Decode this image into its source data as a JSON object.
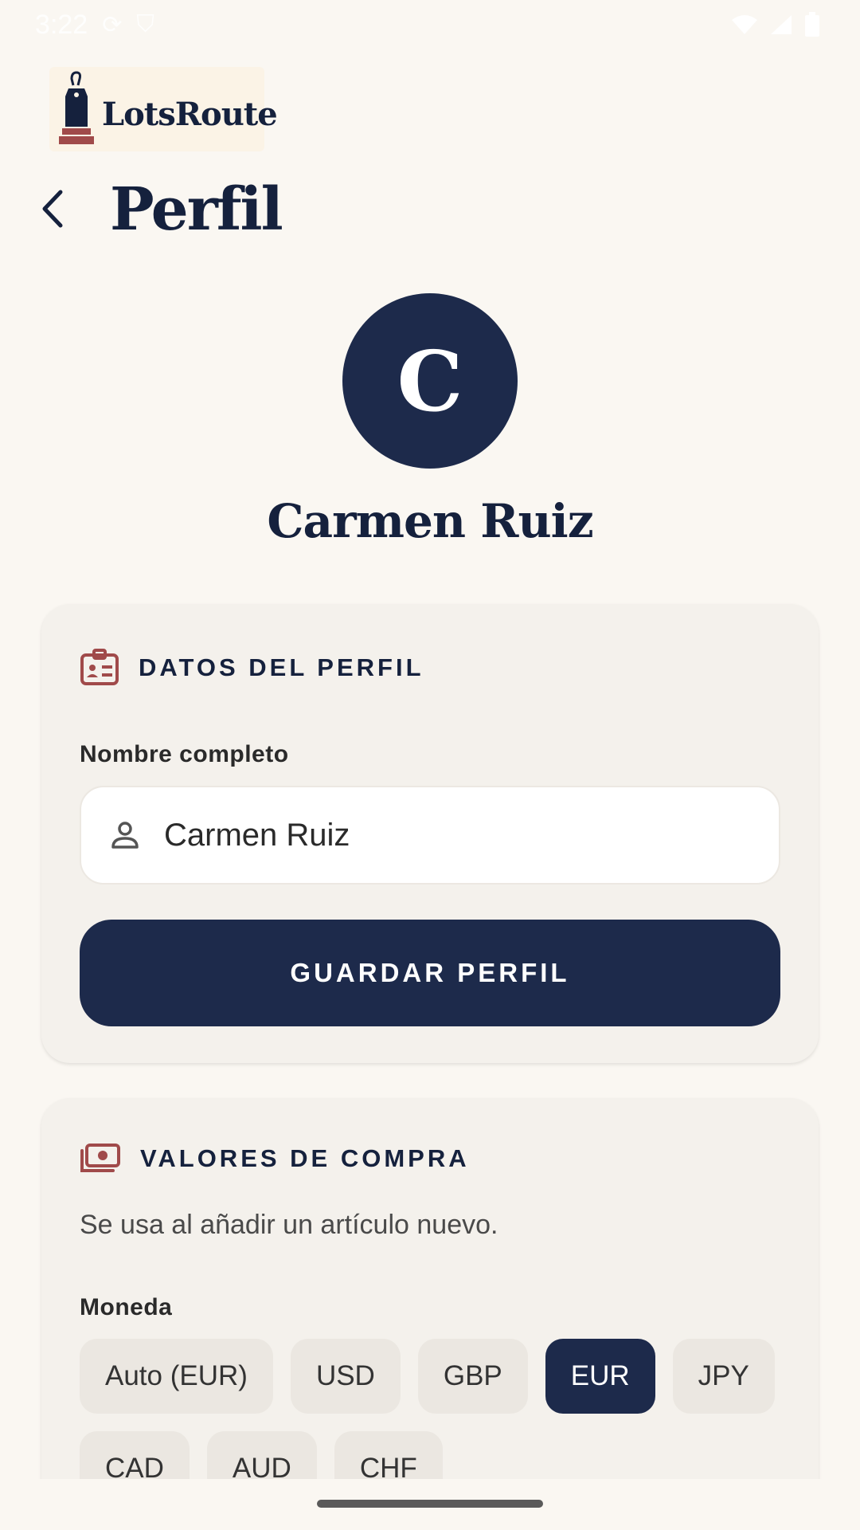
{
  "status_bar": {
    "time": "3:22"
  },
  "logo": {
    "text": "LotsRoute"
  },
  "header": {
    "title": "Perfil"
  },
  "profile": {
    "initial": "C",
    "name": "Carmen Ruiz"
  },
  "profile_card": {
    "title": "DATOS DEL PERFIL",
    "field_label": "Nombre completo",
    "field_value": "Carmen Ruiz",
    "save_label": "GUARDAR PERFIL"
  },
  "purchase_card": {
    "title": "VALORES DE COMPRA",
    "helper": "Se usa al añadir un artículo nuevo.",
    "currency_label": "Moneda",
    "currencies": [
      {
        "label": "Auto (EUR)",
        "selected": false
      },
      {
        "label": "USD",
        "selected": false
      },
      {
        "label": "GBP",
        "selected": false
      },
      {
        "label": "EUR",
        "selected": true
      },
      {
        "label": "JPY",
        "selected": false
      },
      {
        "label": "CAD",
        "selected": false
      },
      {
        "label": "AUD",
        "selected": false
      },
      {
        "label": "CHF",
        "selected": false
      }
    ]
  },
  "colors": {
    "navy": "#1d2a4b",
    "accent_red": "#a04a4a",
    "background": "#faf7f2",
    "card": "#f4f1ec"
  },
  "icons": {
    "back": "arrow-back-icon",
    "profile_section": "id-card-icon",
    "field": "person-icon",
    "purchase_section": "money-icon"
  }
}
